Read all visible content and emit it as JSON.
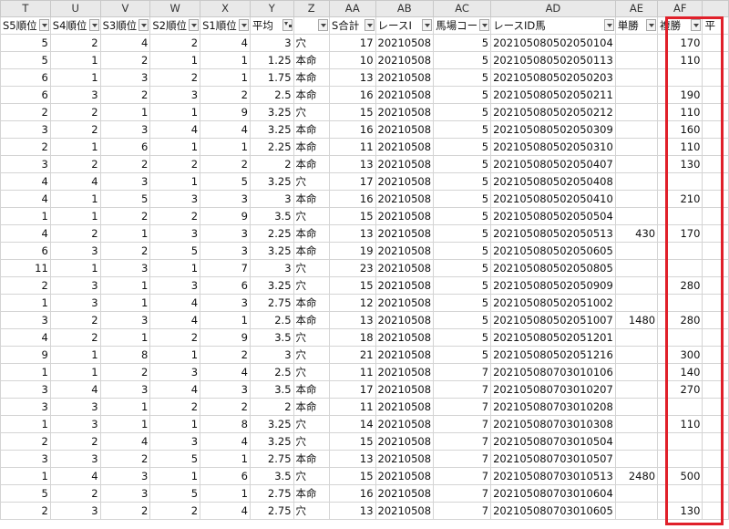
{
  "columns": [
    "T",
    "U",
    "V",
    "W",
    "X",
    "Y",
    "Z",
    "AA",
    "AB",
    "AC",
    "AD",
    "AE",
    "AF"
  ],
  "fields": [
    "S5順位",
    "S4順位",
    "S3順位",
    "S2順位",
    "S1順位",
    "平均",
    "",
    "S合計",
    "レースI",
    "馬場コー",
    "レースID馬",
    "単勝",
    "複勝",
    "平"
  ],
  "rows": [
    [
      "5",
      "2",
      "4",
      "2",
      "4",
      "3",
      "穴",
      "17",
      "20210508",
      "5",
      "202105080502050104",
      "",
      "170"
    ],
    [
      "5",
      "1",
      "2",
      "1",
      "1",
      "1.25",
      "本命",
      "10",
      "20210508",
      "5",
      "202105080502050113",
      "",
      "110"
    ],
    [
      "6",
      "1",
      "3",
      "2",
      "1",
      "1.75",
      "本命",
      "13",
      "20210508",
      "5",
      "202105080502050203",
      "",
      ""
    ],
    [
      "6",
      "3",
      "2",
      "3",
      "2",
      "2.5",
      "本命",
      "16",
      "20210508",
      "5",
      "202105080502050211",
      "",
      "190"
    ],
    [
      "2",
      "2",
      "1",
      "1",
      "9",
      "3.25",
      "穴",
      "15",
      "20210508",
      "5",
      "202105080502050212",
      "",
      "110"
    ],
    [
      "3",
      "2",
      "3",
      "4",
      "4",
      "3.25",
      "本命",
      "16",
      "20210508",
      "5",
      "202105080502050309",
      "",
      "160"
    ],
    [
      "2",
      "1",
      "6",
      "1",
      "1",
      "2.25",
      "本命",
      "11",
      "20210508",
      "5",
      "202105080502050310",
      "",
      "110"
    ],
    [
      "3",
      "2",
      "2",
      "2",
      "2",
      "2",
      "本命",
      "13",
      "20210508",
      "5",
      "202105080502050407",
      "",
      "130"
    ],
    [
      "4",
      "4",
      "3",
      "1",
      "5",
      "3.25",
      "穴",
      "17",
      "20210508",
      "5",
      "202105080502050408",
      "",
      ""
    ],
    [
      "4",
      "1",
      "5",
      "3",
      "3",
      "3",
      "本命",
      "16",
      "20210508",
      "5",
      "202105080502050410",
      "",
      "210"
    ],
    [
      "1",
      "1",
      "2",
      "2",
      "9",
      "3.5",
      "穴",
      "15",
      "20210508",
      "5",
      "202105080502050504",
      "",
      ""
    ],
    [
      "4",
      "2",
      "1",
      "3",
      "3",
      "2.25",
      "本命",
      "13",
      "20210508",
      "5",
      "202105080502050513",
      "430",
      "170"
    ],
    [
      "6",
      "3",
      "2",
      "5",
      "3",
      "3.25",
      "本命",
      "19",
      "20210508",
      "5",
      "202105080502050605",
      "",
      ""
    ],
    [
      "11",
      "1",
      "3",
      "1",
      "7",
      "3",
      "穴",
      "23",
      "20210508",
      "5",
      "202105080502050805",
      "",
      ""
    ],
    [
      "2",
      "3",
      "1",
      "3",
      "6",
      "3.25",
      "穴",
      "15",
      "20210508",
      "5",
      "202105080502050909",
      "",
      "280"
    ],
    [
      "1",
      "3",
      "1",
      "4",
      "3",
      "2.75",
      "本命",
      "12",
      "20210508",
      "5",
      "202105080502051002",
      "",
      ""
    ],
    [
      "3",
      "2",
      "3",
      "4",
      "1",
      "2.5",
      "本命",
      "13",
      "20210508",
      "5",
      "202105080502051007",
      "1480",
      "280"
    ],
    [
      "4",
      "2",
      "1",
      "2",
      "9",
      "3.5",
      "穴",
      "18",
      "20210508",
      "5",
      "202105080502051201",
      "",
      ""
    ],
    [
      "9",
      "1",
      "8",
      "1",
      "2",
      "3",
      "穴",
      "21",
      "20210508",
      "5",
      "202105080502051216",
      "",
      "300"
    ],
    [
      "1",
      "1",
      "2",
      "3",
      "4",
      "2.5",
      "穴",
      "11",
      "20210508",
      "7",
      "202105080703010106",
      "",
      "140"
    ],
    [
      "3",
      "4",
      "3",
      "4",
      "3",
      "3.5",
      "本命",
      "17",
      "20210508",
      "7",
      "202105080703010207",
      "",
      "270"
    ],
    [
      "3",
      "3",
      "1",
      "2",
      "2",
      "2",
      "本命",
      "11",
      "20210508",
      "7",
      "202105080703010208",
      "",
      ""
    ],
    [
      "1",
      "3",
      "1",
      "1",
      "8",
      "3.25",
      "穴",
      "14",
      "20210508",
      "7",
      "202105080703010308",
      "",
      "110"
    ],
    [
      "2",
      "2",
      "4",
      "3",
      "4",
      "3.25",
      "穴",
      "15",
      "20210508",
      "7",
      "202105080703010504",
      "",
      ""
    ],
    [
      "3",
      "3",
      "2",
      "5",
      "1",
      "2.75",
      "本命",
      "13",
      "20210508",
      "7",
      "202105080703010507",
      "",
      ""
    ],
    [
      "1",
      "4",
      "3",
      "1",
      "6",
      "3.5",
      "穴",
      "15",
      "20210508",
      "7",
      "202105080703010513",
      "2480",
      "500"
    ],
    [
      "5",
      "2",
      "3",
      "5",
      "1",
      "2.75",
      "本命",
      "16",
      "20210508",
      "7",
      "202105080703010604",
      "",
      ""
    ],
    [
      "2",
      "3",
      "2",
      "2",
      "4",
      "2.75",
      "穴",
      "13",
      "20210508",
      "7",
      "202105080703010605",
      "",
      "130"
    ]
  ],
  "highlight_color": "#e0202a"
}
